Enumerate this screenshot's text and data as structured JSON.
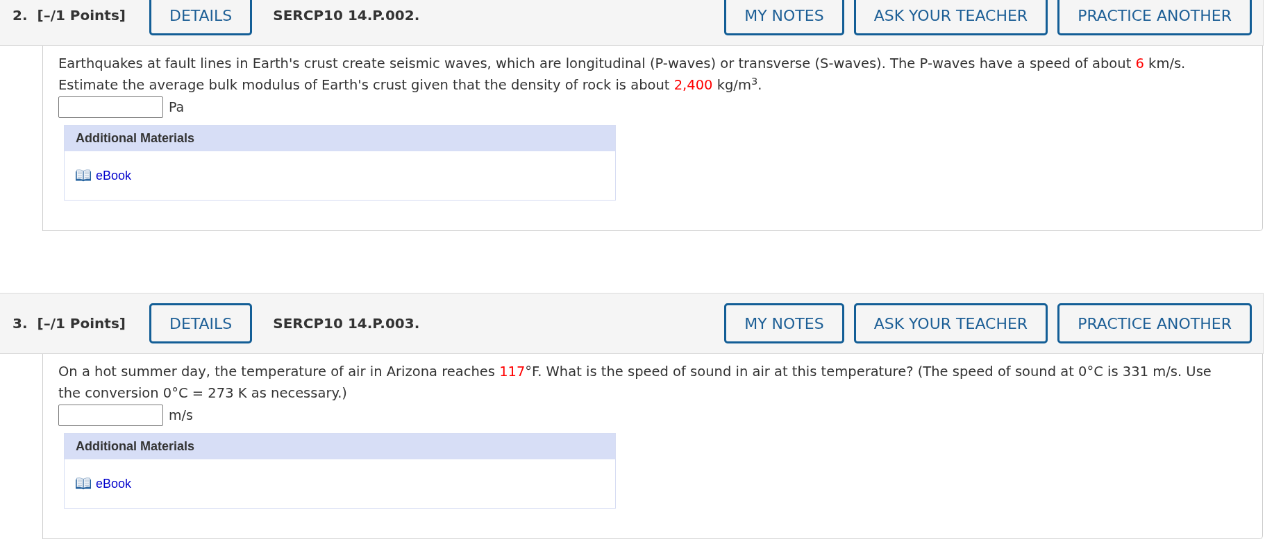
{
  "questions": [
    {
      "number": "2.",
      "points": "[–/1 Points]",
      "details_button": "DETAILS",
      "code": "SERCP10 14.P.002.",
      "header_buttons": [
        "MY NOTES",
        "ASK YOUR TEACHER",
        "PRACTICE ANOTHER"
      ],
      "text": [
        {
          "kind": "plain",
          "text": "Earthquakes at fault lines in Earth's crust create seismic waves, which are longitudinal (P-waves) or transverse (S-waves). The P-waves have a speed of about "
        },
        {
          "kind": "value",
          "text": "6"
        },
        {
          "kind": "plain",
          "text": " km/s. Estimate the average bulk modulus of Earth's crust given that the density of rock is about "
        },
        {
          "kind": "value",
          "text": "2,400"
        },
        {
          "kind": "plain",
          "text": " kg/m$^{3}$."
        }
      ],
      "answer_unit": "Pa",
      "additional_materials": {
        "title": "Additional Materials",
        "links": [
          "eBook"
        ]
      }
    },
    {
      "number": "3.",
      "points": "[–/1 Points]",
      "details_button": "DETAILS",
      "code": "SERCP10 14.P.003.",
      "header_buttons": [
        "MY NOTES",
        "ASK YOUR TEACHER",
        "PRACTICE ANOTHER"
      ],
      "text": [
        {
          "kind": "plain",
          "text": "On a hot summer day, the temperature of air in Arizona reaches "
        },
        {
          "kind": "value",
          "text": "117"
        },
        {
          "kind": "plain",
          "text": "°F. What is the speed of sound in air at this temperature? (The speed of sound at 0°C is 331 m/s. Use the conversion 0°C = 273 K as necessary.)"
        }
      ],
      "answer_unit": "m/s",
      "additional_materials": {
        "title": "Additional Materials",
        "links": [
          "eBook"
        ]
      }
    }
  ]
}
